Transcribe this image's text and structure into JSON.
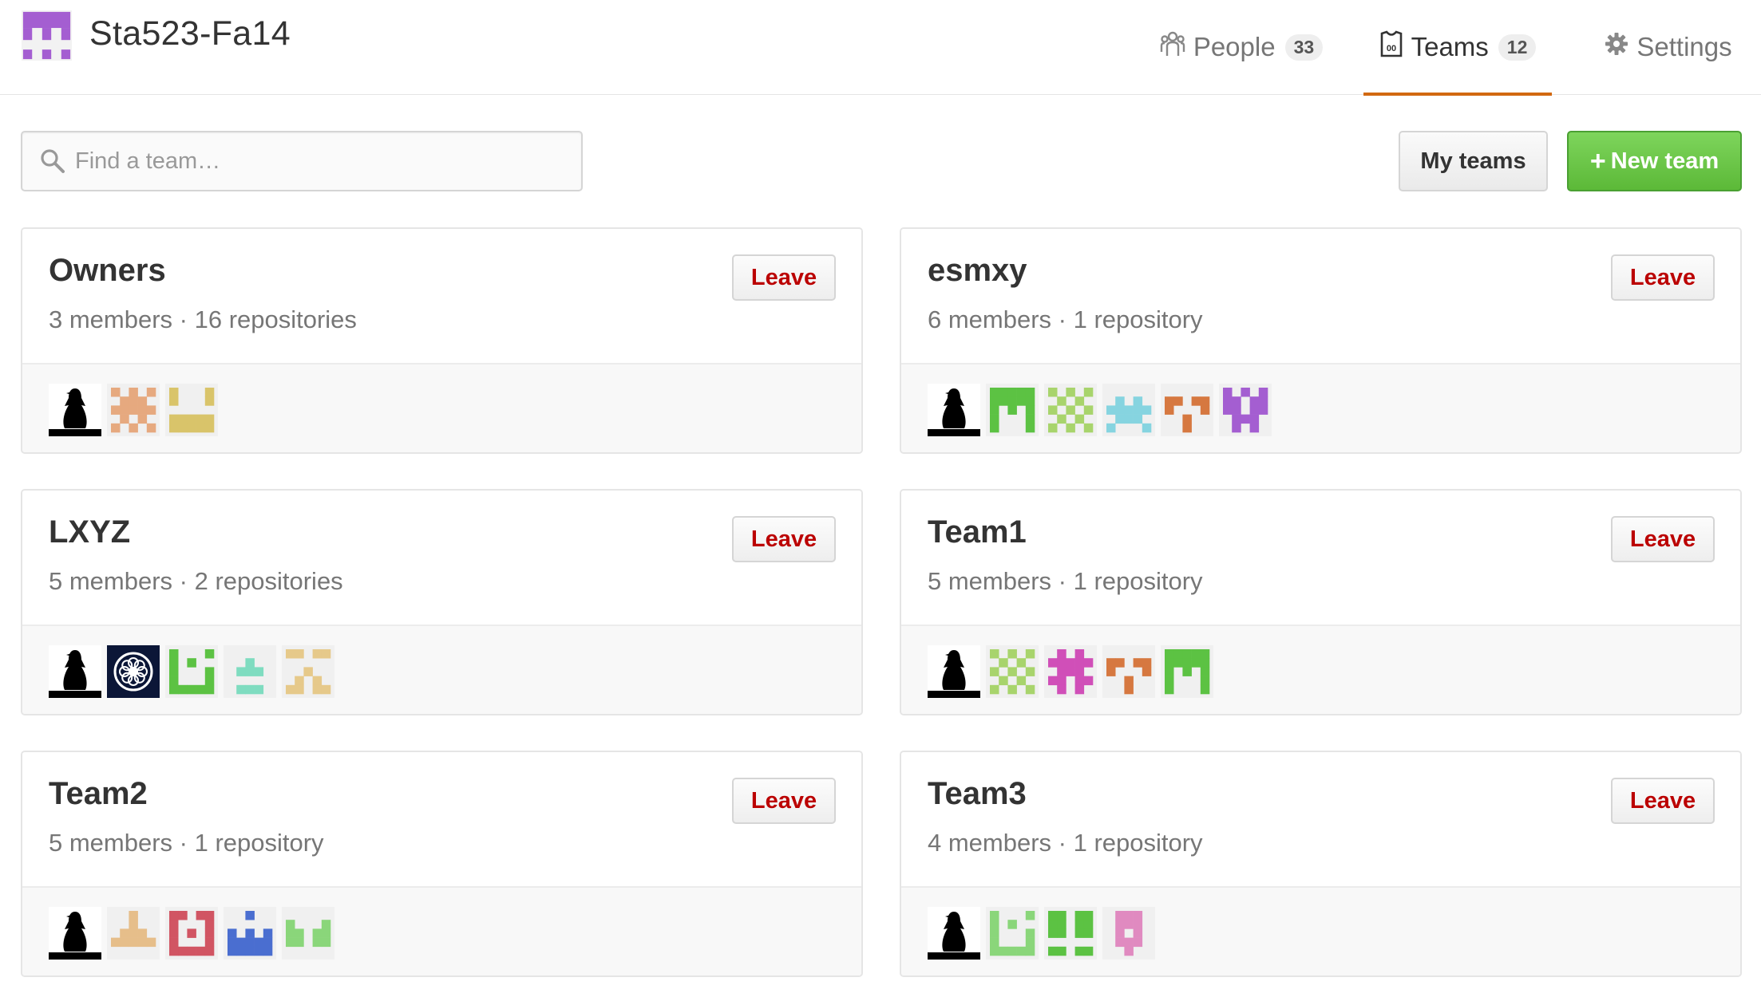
{
  "org": {
    "name": "Sta523-Fa14",
    "avatar_color": "#a45ed1",
    "avatar_icon": "identicon"
  },
  "nav": {
    "people": {
      "label": "People",
      "count": "33",
      "icon": "organization-icon"
    },
    "teams": {
      "label": "Teams",
      "count": "12",
      "icon": "jersey-icon"
    },
    "settings": {
      "label": "Settings",
      "icon": "gear-icon"
    }
  },
  "search": {
    "placeholder": "Find a team…",
    "value": "",
    "icon": "search-icon"
  },
  "buttons": {
    "my_teams": "My teams",
    "new_team_plus": "+",
    "new_team": "New team"
  },
  "colors": {
    "accent_tab": "#d26911",
    "leave": "#bb0000",
    "new_team_green": "#6cc644"
  },
  "teams": [
    {
      "name": "Owners",
      "meta": "3 members · 16 repositories",
      "leave": "Leave",
      "avatars": [
        {
          "type": "penguin"
        },
        {
          "type": "identicon",
          "color": "#e6a97f",
          "pattern": "10101 01110 11111 01010 10101"
        },
        {
          "type": "identicon",
          "color": "#d9c46a",
          "pattern": "10001 10001 00000 11111 11111"
        }
      ]
    },
    {
      "name": "esmxy",
      "meta": "6 members · 1 repository",
      "leave": "Leave",
      "avatars": [
        {
          "type": "penguin"
        },
        {
          "type": "identicon",
          "color": "#5cc243",
          "pattern": "11111 11111 10101 10001 10001"
        },
        {
          "type": "identicon",
          "color": "#a8d46c",
          "pattern": "10101 01010 10101 01010 10101"
        },
        {
          "type": "identicon",
          "color": "#86d4e0",
          "pattern": "00000 01010 11111 01110 10001"
        },
        {
          "type": "identicon",
          "color": "#d67840",
          "pattern": "00000 11011 10001 00100 00100"
        },
        {
          "type": "identicon",
          "color": "#a45ed1",
          "pattern": "10101 11011 11011 01110 01010"
        }
      ]
    },
    {
      "name": "LXYZ",
      "meta": "5 members · 2 repositories",
      "leave": "Leave",
      "avatars": [
        {
          "type": "penguin"
        },
        {
          "type": "emblem"
        },
        {
          "type": "identicon",
          "color": "#5cc243",
          "pattern": "10001 10100 10001 10001 11111"
        },
        {
          "type": "identicon",
          "color": "#7fdcc0",
          "pattern": "00000 00100 01110 00000 01110"
        },
        {
          "type": "identicon",
          "color": "#e6c98a",
          "pattern": "11011 00000 00100 01010 11011"
        }
      ]
    },
    {
      "name": "Team1",
      "meta": "5 members · 1 repository",
      "leave": "Leave",
      "avatars": [
        {
          "type": "penguin"
        },
        {
          "type": "identicon",
          "color": "#a8d46c",
          "pattern": "10101 01010 10101 01010 10101"
        },
        {
          "type": "identicon",
          "color": "#d04fb8",
          "pattern": "01010 11111 01110 11011 01010"
        },
        {
          "type": "identicon",
          "color": "#d67840",
          "pattern": "00000 11011 10001 00100 00100"
        },
        {
          "type": "identicon",
          "color": "#5cc243",
          "pattern": "11111 11111 10101 10001 10001"
        }
      ]
    },
    {
      "name": "Team2",
      "meta": "5 members · 1 repository",
      "leave": "Leave",
      "avatars": [
        {
          "type": "penguin"
        },
        {
          "type": "identicon",
          "color": "#e6be8a",
          "pattern": "00100 00100 01110 11111 00000"
        },
        {
          "type": "identicon",
          "color": "#d15563",
          "pattern": "11011 10001 10101 10001 11111"
        },
        {
          "type": "identicon",
          "color": "#4a6ed0",
          "pattern": "00100 00000 10101 11111 11111"
        },
        {
          "type": "identicon",
          "color": "#8ad67a",
          "pattern": "00000 10001 11011 11011 00000"
        }
      ]
    },
    {
      "name": "Team3",
      "meta": "4 members · 1 repository",
      "leave": "Leave",
      "avatars": [
        {
          "type": "penguin"
        },
        {
          "type": "identicon",
          "color": "#8ad67a",
          "pattern": "10001 10100 10001 10001 11111"
        },
        {
          "type": "identicon",
          "color": "#5cc243",
          "pattern": "11011 11011 11011 00000 11011"
        },
        {
          "type": "identicon",
          "color": "#e08ac0",
          "pattern": "01110 01110 01010 01110 00100"
        }
      ]
    }
  ]
}
